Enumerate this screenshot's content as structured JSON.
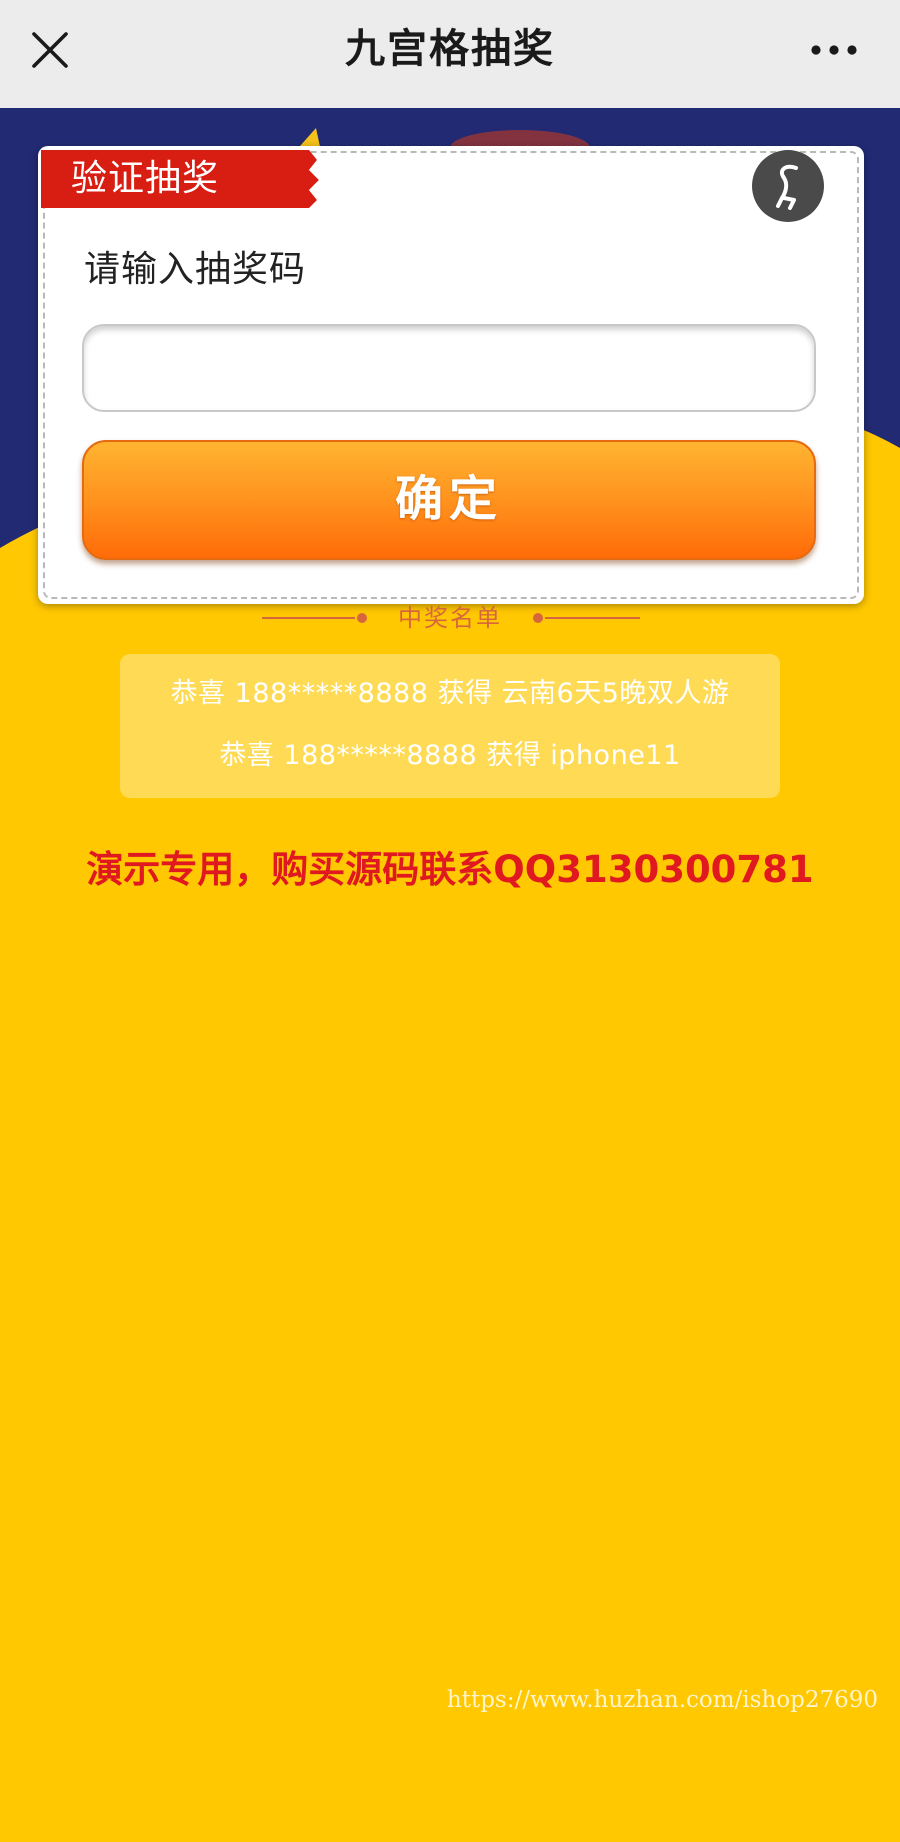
{
  "navbar": {
    "title": "九宫格抽奖",
    "close_icon": "close-icon",
    "more_icon": "more-dots-icon"
  },
  "modal": {
    "ribbon_label": "验证抽奖",
    "prompt_label": "请输入抽奖码",
    "input_value": "",
    "input_placeholder": "",
    "confirm_label": "确定",
    "close_icon": "modal-close-icon"
  },
  "winners": {
    "header_label": "中奖名单",
    "rows": [
      "恭喜 188*****8888 获得 云南6天5晚双人游",
      "恭喜 188*****8888 获得 iphone11"
    ]
  },
  "notice": "演示专用，购买源码联系QQ3130300781",
  "watermark": "https://www.huzhan.com/ishop27690",
  "colors": {
    "page_background": "#ffc800",
    "header_blue": "#222a73",
    "ribbon_red": "#d81e12",
    "button_orange": "#ff8f1c",
    "notice_red": "#e0181f",
    "winners_box": "#ffdb55"
  }
}
